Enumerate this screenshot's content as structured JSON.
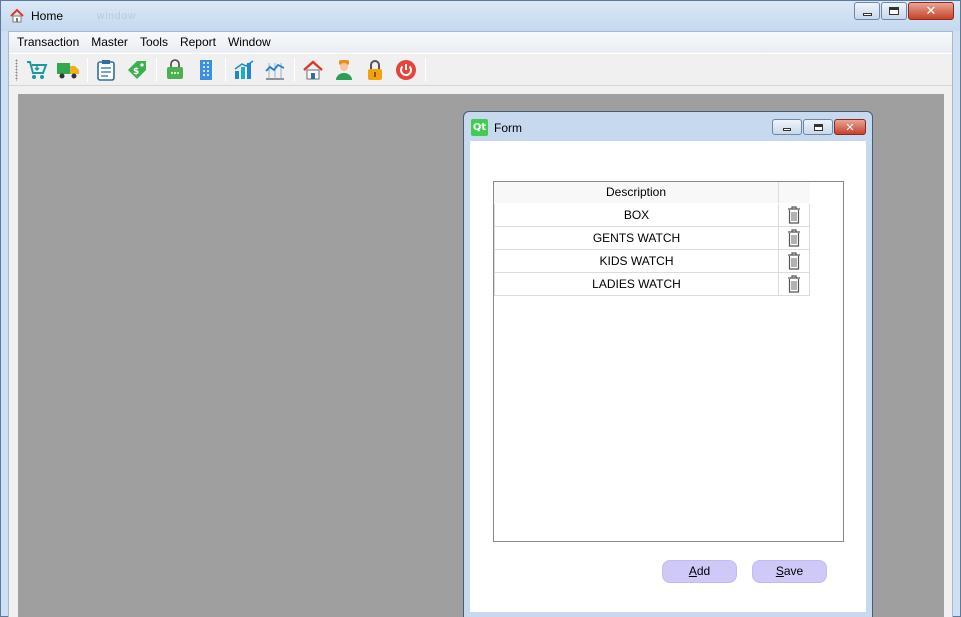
{
  "window": {
    "title": "Home",
    "title_ghost": "window"
  },
  "menu": {
    "items": [
      {
        "label": "Transaction"
      },
      {
        "label": "Master"
      },
      {
        "label": "Tools"
      },
      {
        "label": "Report"
      },
      {
        "label": "Window"
      }
    ]
  },
  "toolbar": {
    "buttons": [
      {
        "icon": "shopping-cart-icon"
      },
      {
        "icon": "delivery-truck-icon"
      },
      {
        "icon": "clipboard-icon"
      },
      {
        "icon": "price-tag-icon"
      },
      {
        "icon": "shopping-bag-icon"
      },
      {
        "icon": "building-icon"
      },
      {
        "icon": "bar-chart-icon"
      },
      {
        "icon": "line-chart-icon"
      },
      {
        "icon": "home-icon"
      },
      {
        "icon": "user-icon"
      },
      {
        "icon": "lock-icon"
      },
      {
        "icon": "power-icon"
      }
    ]
  },
  "form": {
    "title": "Form",
    "qt_logo": "Qt",
    "table": {
      "headers": [
        "Description",
        ""
      ],
      "rows": [
        {
          "description": "BOX"
        },
        {
          "description": "GENTS WATCH"
        },
        {
          "description": "KIDS WATCH"
        },
        {
          "description": "LADIES WATCH"
        }
      ]
    },
    "add_button": {
      "mnemonic": "A",
      "rest": "dd"
    },
    "save_button": {
      "mnemonic": "S",
      "rest": "ave"
    }
  },
  "colors": {
    "mdi_background": "#9f9f9f",
    "button_fill": "#cfc9f7",
    "title_bar": "#c4d8ef",
    "close_button": "#c7412a"
  }
}
